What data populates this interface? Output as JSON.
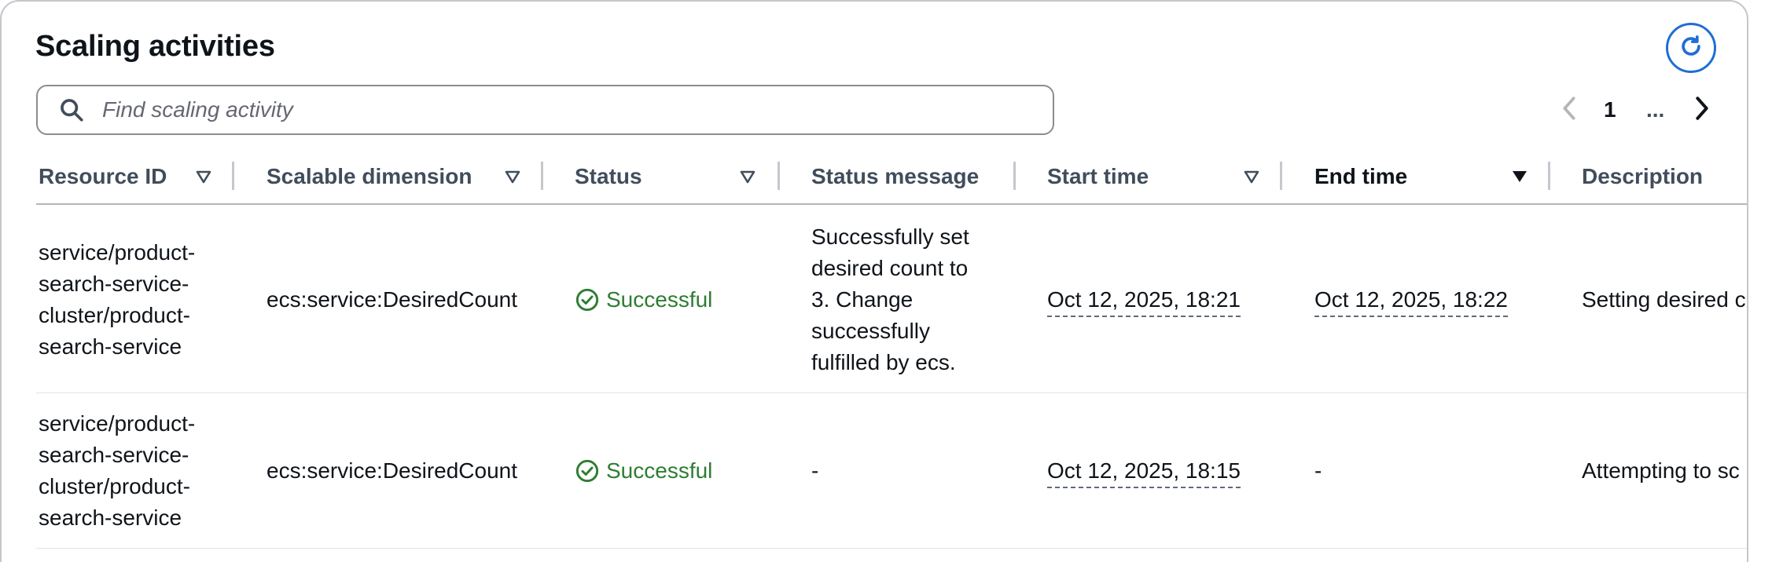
{
  "panel": {
    "title": "Scaling activities"
  },
  "search": {
    "placeholder": "Find scaling activity",
    "value": ""
  },
  "pagination": {
    "current_page": "1",
    "ellipsis": "..."
  },
  "table": {
    "columns": [
      {
        "label": "Resource ID",
        "sortable": true,
        "sorted": false
      },
      {
        "label": "Scalable dimension",
        "sortable": true,
        "sorted": false
      },
      {
        "label": "Status",
        "sortable": true,
        "sorted": false
      },
      {
        "label": "Status message",
        "sortable": false,
        "sorted": false
      },
      {
        "label": "Start time",
        "sortable": true,
        "sorted": false
      },
      {
        "label": "End time",
        "sortable": true,
        "sorted": true
      },
      {
        "label": "Description",
        "sortable": false,
        "sorted": false
      }
    ],
    "rows": [
      {
        "resource_id": [
          "service/product-",
          "search-service-",
          "cluster/product-",
          "search-service"
        ],
        "scalable_dimension": "ecs:service:DesiredCount",
        "status": "Successful",
        "status_message": [
          "Successfully set",
          "desired count to",
          "3. Change",
          "successfully",
          "fulfilled by ecs."
        ],
        "start_time": "Oct 12, 2025, 18:21",
        "end_time": "Oct 12, 2025, 18:22",
        "description": "Setting desired c"
      },
      {
        "resource_id": [
          "service/product-",
          "search-service-",
          "cluster/product-",
          "search-service"
        ],
        "scalable_dimension": "ecs:service:DesiredCount",
        "status": "Successful",
        "status_message": [
          "-"
        ],
        "start_time": "Oct 12, 2025, 18:15",
        "end_time": "-",
        "description": "Attempting to sc"
      }
    ]
  },
  "colors": {
    "accent": "#1f6ed4",
    "success": "#2e7d32",
    "header_text": "#414d5c",
    "border": "#c6c6cd"
  },
  "icons": {
    "refresh": "refresh-icon",
    "search": "search-icon",
    "prev": "chevron-left-icon",
    "next": "chevron-right-icon",
    "sort": "caret-down-icon",
    "status": "check-circle-icon"
  }
}
